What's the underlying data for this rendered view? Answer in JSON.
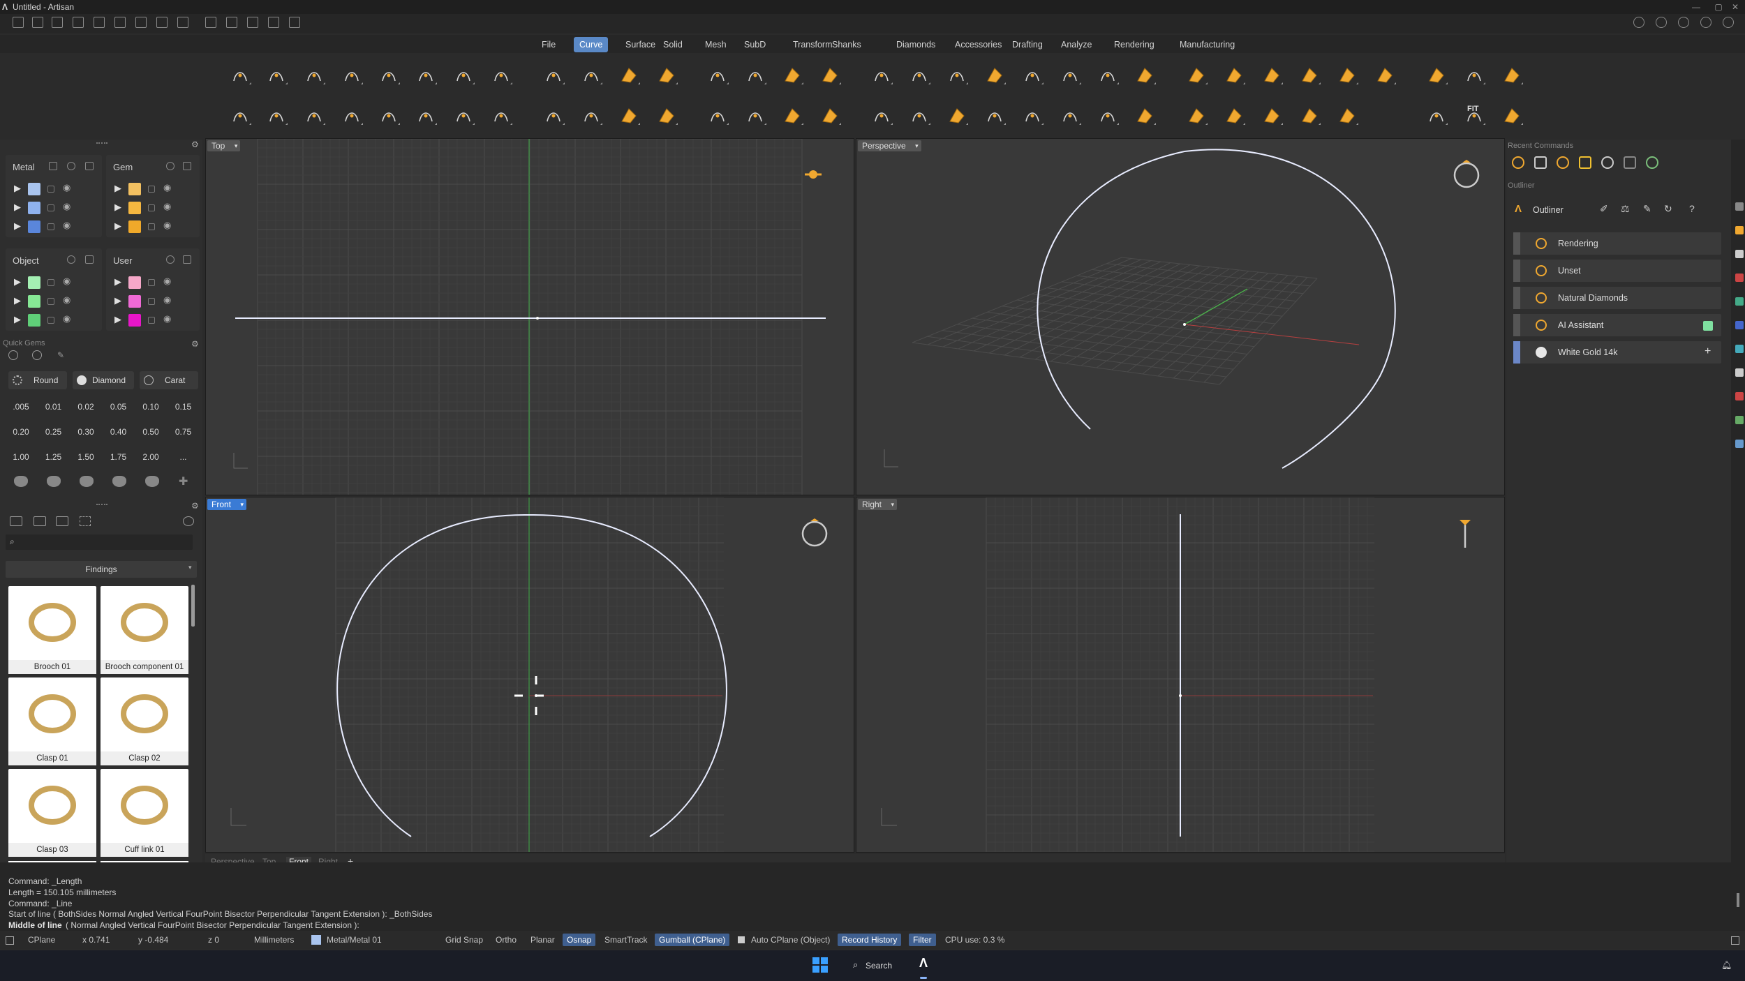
{
  "window": {
    "title": "Untitled - Artisan",
    "minimize": "—",
    "maximize": "▢",
    "close": "✕"
  },
  "menu": {
    "items": [
      "File",
      "Curve",
      "Surface",
      "Solid",
      "Mesh",
      "SubD",
      "Transform",
      "Shanks",
      "Diamonds",
      "Accessories",
      "Drafting",
      "Analyze",
      "Rendering",
      "Manufacturing"
    ],
    "active": "Curve"
  },
  "layers": {
    "metal": "Metal",
    "gem": "Gem",
    "object": "Object",
    "user": "User",
    "metal_colors": [
      "#a9c4ee",
      "#8fb2ee",
      "#5a86db"
    ],
    "gem_colors": [
      "#f2c061",
      "#f5b740",
      "#f0a92a"
    ],
    "object_colors": [
      "#a4f0b3",
      "#86e895",
      "#5fcf78"
    ],
    "user_colors": [
      "#f6a8c9",
      "#f06ad6",
      "#e816c9"
    ]
  },
  "quick_gems": {
    "title": "Quick Gems",
    "shape": "Round",
    "cut": "Diamond",
    "unit": "Carat",
    "sizes": [
      ".005",
      "0.01",
      "0.02",
      "0.05",
      "0.10",
      "0.15",
      "0.20",
      "0.25",
      "0.30",
      "0.40",
      "0.50",
      "0.75",
      "1.00",
      "1.25",
      "1.50",
      "1.75",
      "2.00",
      "..."
    ]
  },
  "library": {
    "category": "Findings",
    "items": [
      "Brooch 01",
      "Brooch component 01",
      "Clasp 01",
      "Clasp 02",
      "Clasp 03",
      "Cuff link 01"
    ]
  },
  "viewports": {
    "top": "Top",
    "perspective": "Perspective",
    "front": "Front",
    "right": "Right",
    "tabs": [
      "Perspective",
      "Top",
      "Front",
      "Right"
    ],
    "active_tab": "Front",
    "add": "+"
  },
  "recent_commands": {
    "title": "Recent Commands"
  },
  "outliner": {
    "section": "Outliner",
    "title": "Outliner",
    "items": [
      "Rendering",
      "Unset",
      "Natural Diamonds",
      "AI Assistant",
      "White Gold 14k"
    ]
  },
  "command_history": [
    "Command: _Length",
    "Length = 150.105 millimeters",
    "Command: _Line",
    "Start of line ( BothSides  Normal  Angled  Vertical  FourPoint  Bisector  Perpendicular  Tangent  Extension ): _BothSides"
  ],
  "command_prompt": {
    "label": "Middle of line",
    "options": "( Normal  Angled  Vertical  FourPoint  Bisector  Perpendicular  Tangent  Extension ):"
  },
  "status": {
    "cplane": "CPlane",
    "x": "x 0.741",
    "y": "y -0.484",
    "z": "z 0",
    "units": "Millimeters",
    "layer": "Metal/Metal 01",
    "grid_snap": "Grid Snap",
    "ortho": "Ortho",
    "planar": "Planar",
    "osnap": "Osnap",
    "smarttrack": "SmartTrack",
    "gumball": "Gumball (CPlane)",
    "auto_cplane": "Auto CPlane (Object)",
    "record_history": "Record History",
    "filter": "Filter",
    "cpu": "CPU use: 0.3 %"
  },
  "taskbar": {
    "search": "Search"
  },
  "colors": {
    "accent": "#5a89c7",
    "orange": "#f0a830",
    "curve": "#e8ecff",
    "axis_green": "#4bb34b",
    "axis_red": "#b84040"
  }
}
